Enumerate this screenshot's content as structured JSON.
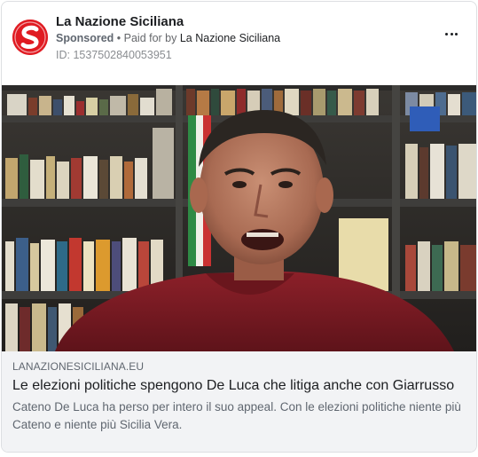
{
  "post": {
    "page_name": "La Nazione Siciliana",
    "sponsored_label": "Sponsored",
    "separator": " • ",
    "paid_for_prefix": "Paid for by ",
    "payer": "La Nazione Siciliana",
    "ad_id": "ID: 1537502840053951",
    "avatar_icon": "logo-s-icon",
    "more_icon": "more-options-icon"
  },
  "link_preview": {
    "domain": "LANAZIONESICILIANA.EU",
    "headline": "Le elezioni politiche spengono De Luca che litiga anche con Giarrusso",
    "description": "Cateno De Luca ha perso per intero il suo appeal. Con le elezioni politiche niente più Cateno e niente più Sicilia Vera."
  },
  "colors": {
    "brand_red": "#e01b22",
    "footer_bg": "#f2f3f5",
    "muted_text": "#606770"
  }
}
